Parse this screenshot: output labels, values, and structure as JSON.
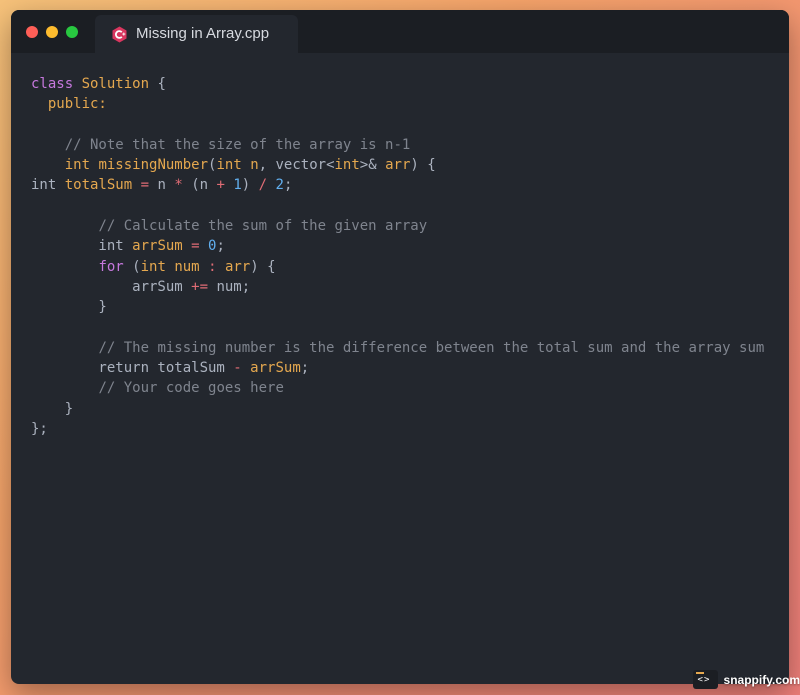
{
  "window": {
    "tab": {
      "title": "Missing in Array.cpp",
      "icon": "cpp-file-icon"
    },
    "controls": [
      "close",
      "minimize",
      "maximize"
    ]
  },
  "code": {
    "lines": [
      [
        {
          "t": "class ",
          "c": "kw"
        },
        {
          "t": "Solution",
          "c": "id"
        },
        {
          "t": " {",
          "c": "pl"
        }
      ],
      [
        {
          "t": "  ",
          "c": "pl"
        },
        {
          "t": "public:",
          "c": "id"
        }
      ],
      [],
      [
        {
          "t": "    ",
          "c": "pl"
        },
        {
          "t": "// Note that the size of the array is n-1",
          "c": "cm"
        }
      ],
      [
        {
          "t": "    ",
          "c": "pl"
        },
        {
          "t": "int",
          "c": "id"
        },
        {
          "t": " ",
          "c": "pl"
        },
        {
          "t": "missingNumber",
          "c": "id"
        },
        {
          "t": "(",
          "c": "pl"
        },
        {
          "t": "int",
          "c": "id"
        },
        {
          "t": " ",
          "c": "pl"
        },
        {
          "t": "n",
          "c": "id"
        },
        {
          "t": ", vector<",
          "c": "pl"
        },
        {
          "t": "int",
          "c": "id"
        },
        {
          "t": ">& ",
          "c": "pl"
        },
        {
          "t": "arr",
          "c": "id"
        },
        {
          "t": ") {",
          "c": "pl"
        }
      ],
      [
        {
          "t": "int ",
          "c": "pl"
        },
        {
          "t": "totalSum",
          "c": "id"
        },
        {
          "t": " ",
          "c": "pl"
        },
        {
          "t": "=",
          "c": "op"
        },
        {
          "t": " n ",
          "c": "pl"
        },
        {
          "t": "*",
          "c": "op"
        },
        {
          "t": " (n ",
          "c": "pl"
        },
        {
          "t": "+",
          "c": "op"
        },
        {
          "t": " ",
          "c": "pl"
        },
        {
          "t": "1",
          "c": "num"
        },
        {
          "t": ") ",
          "c": "pl"
        },
        {
          "t": "/",
          "c": "op"
        },
        {
          "t": " ",
          "c": "pl"
        },
        {
          "t": "2",
          "c": "num"
        },
        {
          "t": ";",
          "c": "pl"
        }
      ],
      [],
      [
        {
          "t": "        ",
          "c": "pl"
        },
        {
          "t": "// Calculate the sum of the given array",
          "c": "cm"
        }
      ],
      [
        {
          "t": "        int ",
          "c": "pl"
        },
        {
          "t": "arrSum",
          "c": "id"
        },
        {
          "t": " ",
          "c": "pl"
        },
        {
          "t": "=",
          "c": "op"
        },
        {
          "t": " ",
          "c": "pl"
        },
        {
          "t": "0",
          "c": "num"
        },
        {
          "t": ";",
          "c": "pl"
        }
      ],
      [
        {
          "t": "        ",
          "c": "pl"
        },
        {
          "t": "for",
          "c": "kw"
        },
        {
          "t": " (",
          "c": "pl"
        },
        {
          "t": "int",
          "c": "id"
        },
        {
          "t": " ",
          "c": "pl"
        },
        {
          "t": "num",
          "c": "id"
        },
        {
          "t": " ",
          "c": "pl"
        },
        {
          "t": ":",
          "c": "op"
        },
        {
          "t": " ",
          "c": "pl"
        },
        {
          "t": "arr",
          "c": "id"
        },
        {
          "t": ") {",
          "c": "pl"
        }
      ],
      [
        {
          "t": "            arrSum ",
          "c": "pl"
        },
        {
          "t": "+=",
          "c": "op"
        },
        {
          "t": " num;",
          "c": "pl"
        }
      ],
      [
        {
          "t": "        }",
          "c": "pl"
        }
      ],
      [],
      [
        {
          "t": "        ",
          "c": "pl"
        },
        {
          "t": "// The missing number is the difference between the total sum and the array sum",
          "c": "cm"
        }
      ],
      [
        {
          "t": "        return totalSum ",
          "c": "pl"
        },
        {
          "t": "-",
          "c": "op"
        },
        {
          "t": " ",
          "c": "pl"
        },
        {
          "t": "arrSum",
          "c": "id"
        },
        {
          "t": ";",
          "c": "pl"
        }
      ],
      [
        {
          "t": "        ",
          "c": "pl"
        },
        {
          "t": "// Your code goes here",
          "c": "cm"
        }
      ],
      [
        {
          "t": "    }",
          "c": "pl"
        }
      ],
      [
        {
          "t": "};",
          "c": "pl"
        }
      ]
    ]
  },
  "watermark": {
    "text": "snappify.com",
    "icon": "code-brackets-icon"
  },
  "colors": {
    "window_bg": "#23272e",
    "titlebar_bg": "#1b1e23",
    "close": "#ff5f57",
    "minimize": "#febc2e",
    "maximize": "#28c840",
    "comment": "#7f848e",
    "identifier": "#e5a84f",
    "keyword": "#c678dd",
    "operator": "#e06c75",
    "number": "#61afef",
    "text": "#abb2bf"
  }
}
